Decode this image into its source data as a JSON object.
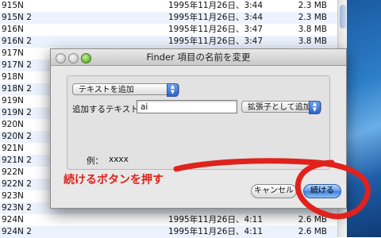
{
  "finder_rows": [
    {
      "name": "915N",
      "date": "1995年11月26日、3:44",
      "size": "2.3 MB"
    },
    {
      "name": "915N 2",
      "date": "1995年11月26日、3:44",
      "size": "2.3 MB"
    },
    {
      "name": "916N",
      "date": "1995年11月26日、3:47",
      "size": "3.8 MB"
    },
    {
      "name": "916N 2",
      "date": "1995年11月26日、3:47",
      "size": "3.8 MB"
    },
    {
      "name": "917N",
      "date": "",
      "size": ""
    },
    {
      "name": "917N 2",
      "date": "",
      "size": ""
    },
    {
      "name": "918N",
      "date": "",
      "size": ""
    },
    {
      "name": "918N 2",
      "date": "",
      "size": ""
    },
    {
      "name": "919N",
      "date": "",
      "size": ""
    },
    {
      "name": "919N 2",
      "date": "",
      "size": ""
    },
    {
      "name": "920N",
      "date": "",
      "size": ""
    },
    {
      "name": "920N 2",
      "date": "",
      "size": ""
    },
    {
      "name": "921N",
      "date": "",
      "size": ""
    },
    {
      "name": "921N 2",
      "date": "",
      "size": ""
    },
    {
      "name": "922N",
      "date": "",
      "size": ""
    },
    {
      "name": "922N 2",
      "date": "",
      "size": ""
    },
    {
      "name": "923N",
      "date": "",
      "size": ""
    },
    {
      "name": "923N 2",
      "date": "",
      "size": ""
    },
    {
      "name": "924N",
      "date": "1995年11月26日、4:11",
      "size": "2.6 MB"
    },
    {
      "name": "924N 2",
      "date": "1995年11月26日、4:11",
      "size": "2.6 MB"
    }
  ],
  "dialog": {
    "title": "Finder 項目の名前を変更",
    "action_popup": "テキストを追加",
    "add_text_label": "追加するテキスト：",
    "add_text_value": "ai",
    "position_popup": "拡張子として追加",
    "example_label": "例：",
    "example_value": "xxxx",
    "cancel_label": "キャンセル",
    "continue_label": "続ける"
  },
  "annotation": {
    "text": "続けるボタンを押す",
    "color": "#e0221c"
  }
}
